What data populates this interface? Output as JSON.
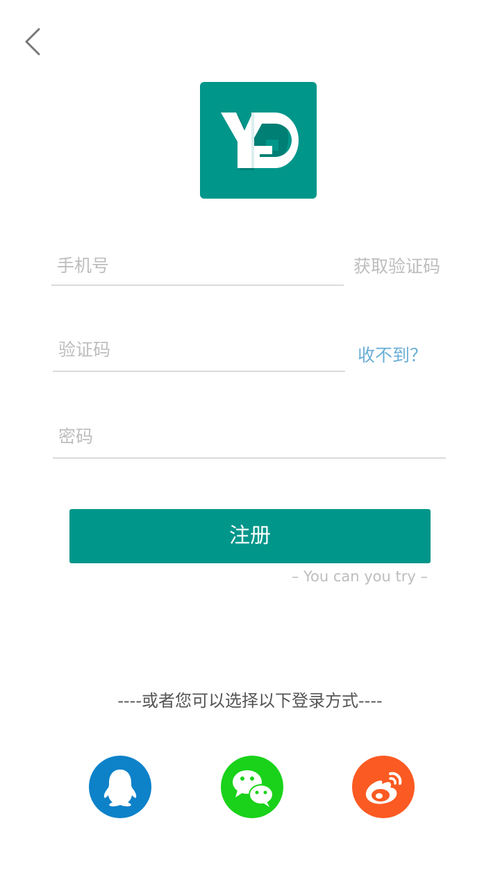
{
  "colors": {
    "accent": "#00968a",
    "link": "#6aaed6",
    "placeholder": "#bdbdbd",
    "qq": "#0d82c9",
    "wechat": "#1ad21a",
    "weibo": "#fb5a22"
  },
  "header": {
    "back_icon": "chevron-left-icon"
  },
  "logo": {
    "name": "yg-logo"
  },
  "form": {
    "phone": {
      "placeholder": "手机号",
      "action_label": "获取验证码"
    },
    "code": {
      "placeholder": "验证码",
      "action_label": "收不到？"
    },
    "password": {
      "placeholder": "密码"
    }
  },
  "register_button_label": "注册",
  "tagline": "– You can you try –",
  "alt_login": {
    "divider_text": "----或者您可以选择以下登录方式----",
    "providers": [
      {
        "name": "QQ",
        "icon": "qq-icon"
      },
      {
        "name": "WeChat",
        "icon": "wechat-icon"
      },
      {
        "name": "Weibo",
        "icon": "weibo-icon"
      }
    ]
  }
}
